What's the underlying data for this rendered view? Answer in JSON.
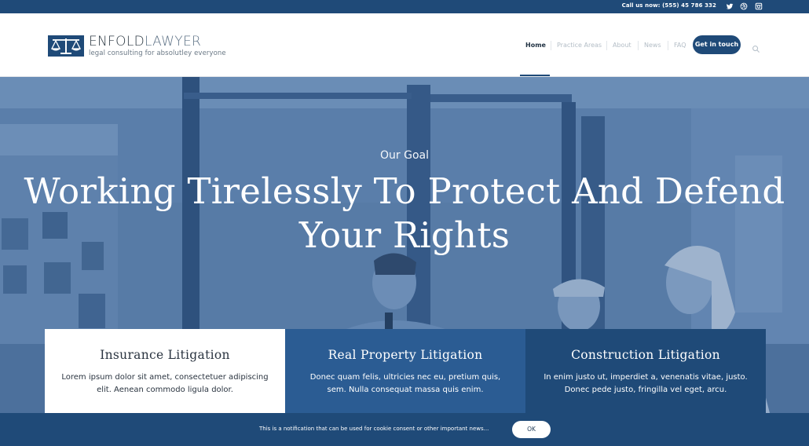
{
  "topbar": {
    "call_text": "Call us now: (555) 45 786 332",
    "social": [
      "twitter-icon",
      "dribbble-icon",
      "instagram-icon"
    ]
  },
  "brand": {
    "name_part1": "ENFOLD",
    "name_part2": "LAWYER",
    "tagline": "legal consulting for absolutley everyone",
    "logo_icon": "scales-icon"
  },
  "nav": {
    "items": [
      {
        "label": "Home",
        "active": true
      },
      {
        "label": "Practice Areas",
        "active": false
      },
      {
        "label": "About",
        "active": false
      },
      {
        "label": "News",
        "active": false
      },
      {
        "label": "FAQ",
        "active": false
      }
    ],
    "cta_label": "Get in touch",
    "search_icon": "search-icon"
  },
  "hero": {
    "eyebrow": "Our Goal",
    "headline_line1": "Working Tirelessly To Protect And Defend",
    "headline_line2": "Your Rights"
  },
  "cards": [
    {
      "title": "Insurance Litigation",
      "text": "Lorem ipsum dolor sit amet, consectetuer adipiscing elit. Aenean commodo ligula dolor."
    },
    {
      "title": "Real Property Litigation",
      "text": "Donec quam felis, ultricies nec eu, pretium quis, sem. Nulla consequat massa quis enim."
    },
    {
      "title": "Construction Litigation",
      "text": "In enim justo ut, imperdiet a, venenatis vitae, justo. Donec pede justo, fringilla vel eget, arcu."
    }
  ],
  "cookie": {
    "message": "This is a notification that can be used for cookie consent or other important news...",
    "ok_label": "OK"
  },
  "colors": {
    "brand_blue": "#1f4a78",
    "card_mid_blue": "#2b5c93",
    "hero_tint": "#5e7ea3"
  }
}
